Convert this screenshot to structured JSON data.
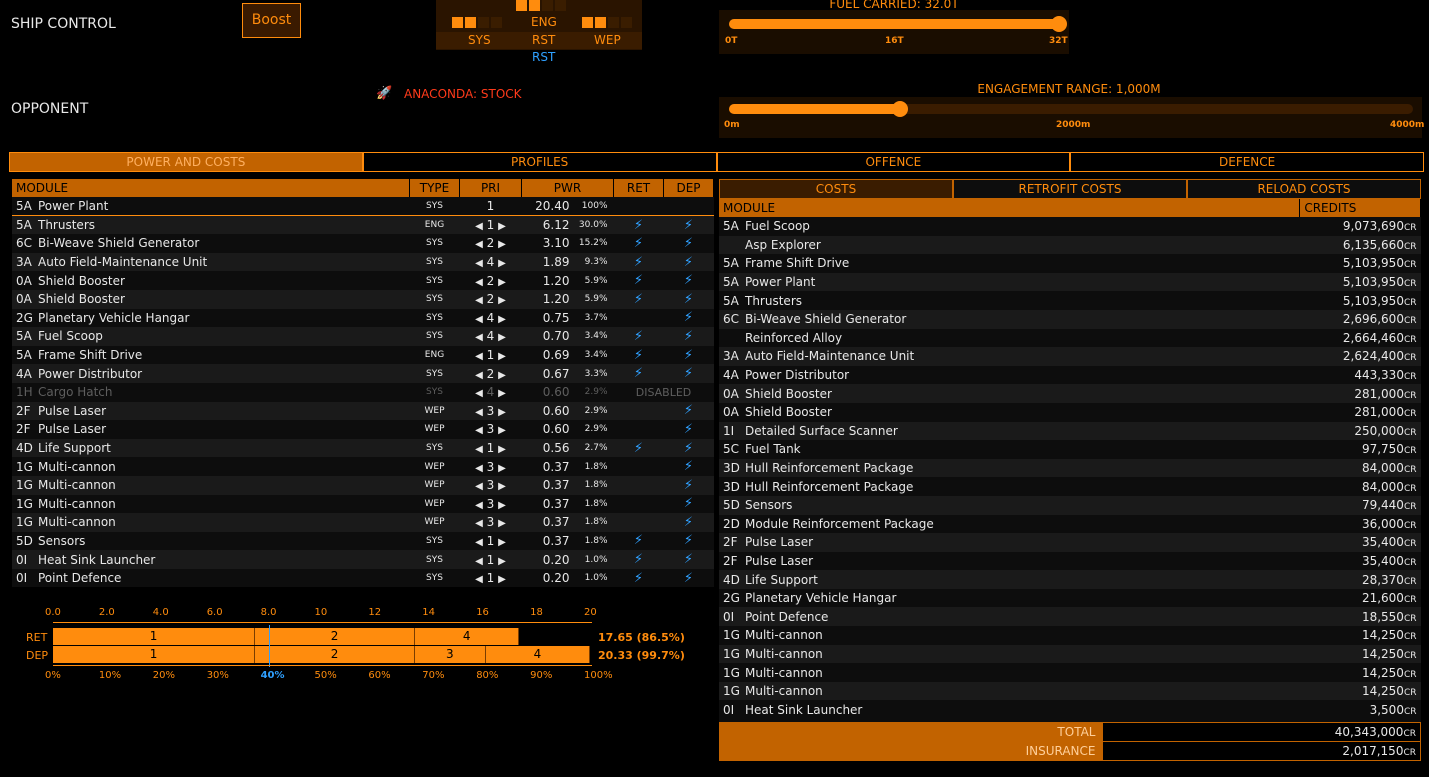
{
  "header": {
    "ship_control": "SHIP CONTROL",
    "opponent": "OPPONENT",
    "boost": "Boost",
    "pips": {
      "eng": "ENG",
      "sys": "SYS",
      "rst": "RST",
      "wep": "WEP",
      "rst2": "RST"
    },
    "fuel": {
      "label": "FUEL CARRIED: 32.0T",
      "ticks": [
        "0T",
        "16T",
        "32T"
      ],
      "level": 1.0
    },
    "range": {
      "label": "ENGAGEMENT RANGE: 1,000M",
      "ticks": [
        "0m",
        "2000m",
        "4000m"
      ],
      "level": 0.25
    },
    "opponent_ship": "ANACONDA: STOCK"
  },
  "tabs": [
    "POWER AND COSTS",
    "PROFILES",
    "OFFENCE",
    "DEFENCE"
  ],
  "modules": {
    "headers": [
      "MODULE",
      "TYPE",
      "PRI",
      "PWR",
      "RET",
      "DEP"
    ],
    "rows": [
      {
        "cls": "5A",
        "name": "Power Plant",
        "type": "SYS",
        "pri": "1",
        "pwr": "20.40",
        "pct": "100%",
        "ret": "",
        "dep": ""
      },
      {
        "cls": "5A",
        "name": "Thrusters",
        "type": "ENG",
        "pri": "1",
        "pwr": "6.12",
        "pct": "30.0%",
        "ret": "⚡",
        "dep": "⚡"
      },
      {
        "cls": "6C",
        "name": "Bi-Weave Shield Generator",
        "type": "SYS",
        "pri": "2",
        "pwr": "3.10",
        "pct": "15.2%",
        "ret": "⚡",
        "dep": "⚡"
      },
      {
        "cls": "3A",
        "name": "Auto Field-Maintenance Unit",
        "type": "SYS",
        "pri": "4",
        "pwr": "1.89",
        "pct": "9.3%",
        "ret": "⚡",
        "dep": "⚡"
      },
      {
        "cls": "0A",
        "name": "Shield Booster",
        "type": "SYS",
        "pri": "2",
        "pwr": "1.20",
        "pct": "5.9%",
        "ret": "⚡",
        "dep": "⚡"
      },
      {
        "cls": "0A",
        "name": "Shield Booster",
        "type": "SYS",
        "pri": "2",
        "pwr": "1.20",
        "pct": "5.9%",
        "ret": "⚡",
        "dep": "⚡"
      },
      {
        "cls": "2G",
        "name": "Planetary Vehicle Hangar",
        "type": "SYS",
        "pri": "4",
        "pwr": "0.75",
        "pct": "3.7%",
        "ret": "",
        "dep": "⚡"
      },
      {
        "cls": "5A",
        "name": "Fuel Scoop",
        "type": "SYS",
        "pri": "4",
        "pwr": "0.70",
        "pct": "3.4%",
        "ret": "⚡",
        "dep": "⚡"
      },
      {
        "cls": "5A",
        "name": "Frame Shift Drive",
        "type": "ENG",
        "pri": "1",
        "pwr": "0.69",
        "pct": "3.4%",
        "ret": "⚡",
        "dep": "⚡"
      },
      {
        "cls": "4A",
        "name": "Power Distributor",
        "type": "SYS",
        "pri": "2",
        "pwr": "0.67",
        "pct": "3.3%",
        "ret": "⚡",
        "dep": "⚡"
      },
      {
        "cls": "1H",
        "name": "Cargo Hatch",
        "type": "SYS",
        "pri": "4",
        "pwr": "0.60",
        "pct": "2.9%",
        "ret": "DISABLED",
        "dep": "",
        "disabled": true
      },
      {
        "cls": "2F",
        "name": "Pulse Laser",
        "type": "WEP",
        "pri": "3",
        "pwr": "0.60",
        "pct": "2.9%",
        "ret": "",
        "dep": "⚡"
      },
      {
        "cls": "2F",
        "name": "Pulse Laser",
        "type": "WEP",
        "pri": "3",
        "pwr": "0.60",
        "pct": "2.9%",
        "ret": "",
        "dep": "⚡"
      },
      {
        "cls": "4D",
        "name": "Life Support",
        "type": "SYS",
        "pri": "1",
        "pwr": "0.56",
        "pct": "2.7%",
        "ret": "⚡",
        "dep": "⚡"
      },
      {
        "cls": "1G",
        "name": "Multi-cannon",
        "type": "WEP",
        "pri": "3",
        "pwr": "0.37",
        "pct": "1.8%",
        "ret": "",
        "dep": "⚡"
      },
      {
        "cls": "1G",
        "name": "Multi-cannon",
        "type": "WEP",
        "pri": "3",
        "pwr": "0.37",
        "pct": "1.8%",
        "ret": "",
        "dep": "⚡"
      },
      {
        "cls": "1G",
        "name": "Multi-cannon",
        "type": "WEP",
        "pri": "3",
        "pwr": "0.37",
        "pct": "1.8%",
        "ret": "",
        "dep": "⚡"
      },
      {
        "cls": "1G",
        "name": "Multi-cannon",
        "type": "WEP",
        "pri": "3",
        "pwr": "0.37",
        "pct": "1.8%",
        "ret": "",
        "dep": "⚡"
      },
      {
        "cls": "5D",
        "name": "Sensors",
        "type": "SYS",
        "pri": "1",
        "pwr": "0.37",
        "pct": "1.8%",
        "ret": "⚡",
        "dep": "⚡"
      },
      {
        "cls": "0I",
        "name": "Heat Sink Launcher",
        "type": "SYS",
        "pri": "1",
        "pwr": "0.20",
        "pct": "1.0%",
        "ret": "⚡",
        "dep": "⚡"
      },
      {
        "cls": "0I",
        "name": "Point Defence",
        "type": "SYS",
        "pri": "1",
        "pwr": "0.20",
        "pct": "1.0%",
        "ret": "⚡",
        "dep": "⚡"
      }
    ]
  },
  "power_chart": {
    "top_ticks": [
      "0.0",
      "2.0",
      "4.0",
      "6.0",
      "8.0",
      "10",
      "12",
      "14",
      "16",
      "18",
      "20"
    ],
    "bottom_ticks": [
      "0%",
      "10%",
      "20%",
      "30%",
      "40%",
      "50%",
      "60%",
      "70%",
      "80%",
      "90%",
      "100%"
    ],
    "max": 20.4,
    "marker_pct": 40,
    "ret": {
      "label": "RET",
      "summary": "17.65 (86.5%)",
      "segments": [
        {
          "p": "1",
          "v": 7.65
        },
        {
          "p": "2",
          "v": 6.05
        },
        {
          "p": "4",
          "v": 3.95
        }
      ]
    },
    "dep": {
      "label": "DEP",
      "summary": "20.33 (99.7%)",
      "segments": [
        {
          "p": "1",
          "v": 7.65
        },
        {
          "p": "2",
          "v": 6.05
        },
        {
          "p": "3",
          "v": 2.68
        },
        {
          "p": "4",
          "v": 3.95
        }
      ]
    }
  },
  "costs": {
    "tabs": [
      "COSTS",
      "RETROFIT COSTS",
      "RELOAD COSTS"
    ],
    "headers": [
      "MODULE",
      "CREDITS"
    ],
    "unit": "CR",
    "rows": [
      {
        "cls": "5A",
        "name": "Fuel Scoop",
        "credits": "9,073,690"
      },
      {
        "cls": "",
        "name": "Asp Explorer",
        "credits": "6,135,660"
      },
      {
        "cls": "5A",
        "name": "Frame Shift Drive",
        "credits": "5,103,950"
      },
      {
        "cls": "5A",
        "name": "Power Plant",
        "credits": "5,103,950"
      },
      {
        "cls": "5A",
        "name": "Thrusters",
        "credits": "5,103,950"
      },
      {
        "cls": "6C",
        "name": "Bi-Weave Shield Generator",
        "credits": "2,696,600"
      },
      {
        "cls": "",
        "name": "Reinforced Alloy",
        "credits": "2,664,460"
      },
      {
        "cls": "3A",
        "name": "Auto Field-Maintenance Unit",
        "credits": "2,624,400"
      },
      {
        "cls": "4A",
        "name": "Power Distributor",
        "credits": "443,330"
      },
      {
        "cls": "0A",
        "name": "Shield Booster",
        "credits": "281,000"
      },
      {
        "cls": "0A",
        "name": "Shield Booster",
        "credits": "281,000"
      },
      {
        "cls": "1I",
        "name": "Detailed Surface Scanner",
        "credits": "250,000"
      },
      {
        "cls": "5C",
        "name": "Fuel Tank",
        "credits": "97,750"
      },
      {
        "cls": "3D",
        "name": "Hull Reinforcement Package",
        "credits": "84,000"
      },
      {
        "cls": "3D",
        "name": "Hull Reinforcement Package",
        "credits": "84,000"
      },
      {
        "cls": "5D",
        "name": "Sensors",
        "credits": "79,440"
      },
      {
        "cls": "2D",
        "name": "Module Reinforcement Package",
        "credits": "36,000"
      },
      {
        "cls": "2F",
        "name": "Pulse Laser",
        "credits": "35,400"
      },
      {
        "cls": "2F",
        "name": "Pulse Laser",
        "credits": "35,400"
      },
      {
        "cls": "4D",
        "name": "Life Support",
        "credits": "28,370"
      },
      {
        "cls": "2G",
        "name": "Planetary Vehicle Hangar",
        "credits": "21,600"
      },
      {
        "cls": "0I",
        "name": "Point Defence",
        "credits": "18,550"
      },
      {
        "cls": "1G",
        "name": "Multi-cannon",
        "credits": "14,250"
      },
      {
        "cls": "1G",
        "name": "Multi-cannon",
        "credits": "14,250"
      },
      {
        "cls": "1G",
        "name": "Multi-cannon",
        "credits": "14,250"
      },
      {
        "cls": "1G",
        "name": "Multi-cannon",
        "credits": "14,250"
      },
      {
        "cls": "0I",
        "name": "Heat Sink Launcher",
        "credits": "3,500"
      }
    ],
    "total_label": "TOTAL",
    "total": "40,343,000",
    "insurance_label": "INSURANCE",
    "insurance": "2,017,150"
  }
}
